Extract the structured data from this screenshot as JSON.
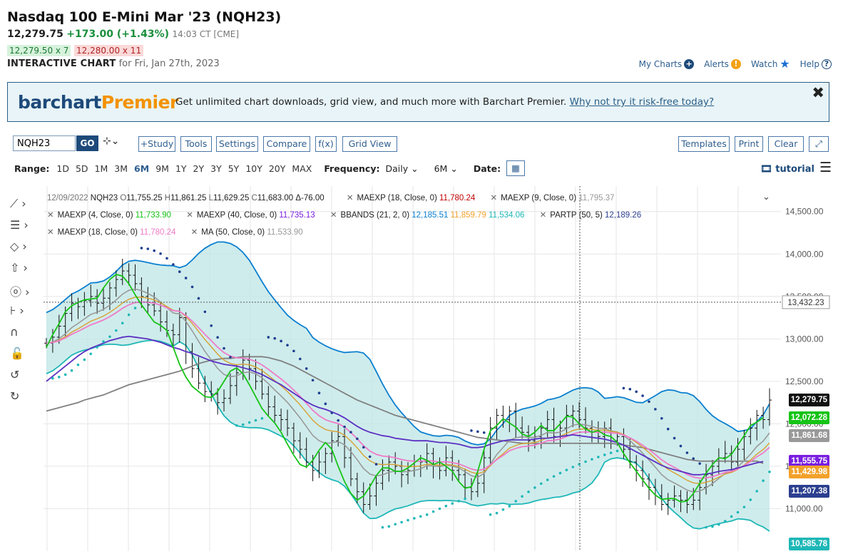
{
  "header": {
    "title": "Nasdaq 100 E-Mini Mar '23 (NQH23)",
    "last": "12,279.75",
    "change": "+173.00 (+1.43%)",
    "time": "14:03 CT [CME]",
    "bid": "12,279.50 x 7",
    "ask": "12,280.00 x 11",
    "interactive_label": "INTERACTIVE CHART",
    "interactive_sub": "for Fri, Jan 27th, 2023"
  },
  "toplinks": {
    "my_charts": "My Charts",
    "alerts": "Alerts",
    "watch": "Watch",
    "help": "Help"
  },
  "promo": {
    "logo_a": "barchart",
    "logo_b": "Premier",
    "message": "Get unlimited chart downloads, grid view, and much more with Barchart Premier.",
    "link": "Why not try it risk-free today?",
    "close": "✖"
  },
  "toolbar": {
    "symbol": "NQH23",
    "go": "GO",
    "buttons_left": [
      "+Study",
      "Tools",
      "Settings",
      "Compare",
      "f(x)",
      "Grid View"
    ],
    "buttons_right": [
      "Templates",
      "Print",
      "Clear"
    ]
  },
  "rangebar": {
    "range_label": "Range:",
    "ranges": [
      "1D",
      "5D",
      "1M",
      "3M",
      "6M",
      "9M",
      "1Y",
      "2Y",
      "3Y",
      "5Y",
      "10Y",
      "20Y",
      "MAX"
    ],
    "active_range": "6M",
    "frequency_label": "Frequency:",
    "frequency": "Daily",
    "period": "6M",
    "date_label": "Date:",
    "tutorial": "tutorial"
  },
  "legend": {
    "row1": {
      "date": "12/09/2022",
      "symbol": "NQH23",
      "ohlc": [
        "O",
        "11,755.25",
        "H",
        "11,861.25",
        "L",
        "11,629.25",
        "C",
        "11,683.00",
        "Δ-76.00"
      ],
      "s1": {
        "label": "MAEXP (18, Close, 0)",
        "value": "11,780.24"
      },
      "s2": {
        "label": "MAEXP (9, Close, 0)",
        "value": "11,795.37"
      }
    },
    "row2": [
      {
        "label": "MAEXP (4, Close, 0)",
        "value": "11,733.90"
      },
      {
        "label": "MAEXP (40, Close, 0)",
        "value": "11,735.13"
      },
      {
        "label": "BBANDS (21, 2, 0)",
        "values": [
          "12,185.51",
          "11,859.79",
          "11,534.06"
        ]
      },
      {
        "label": "PARTP (50, 5)",
        "value": "12,189.26"
      }
    ],
    "row3": [
      {
        "label": "MAEXP (18, Close, 0)",
        "value": "11,780.24"
      },
      {
        "label": "MA (50, Close, 0)",
        "value": "11,533.90"
      }
    ]
  },
  "colors": {
    "bb_band": "#0a7fd0",
    "bb_fill": "#bfe6e6",
    "maexp4": "#16c416",
    "maexp9": "#999999",
    "maexp18": "#f07ac8",
    "maexp40": "#5a2fc2",
    "ma50": "#808080",
    "sma_gold": "#d9a030",
    "sar": "#1fb7b7",
    "price": "#111111"
  },
  "chart_data": {
    "type": "candlestick",
    "y_ticks": [
      "14,500.00",
      "14,000.00",
      "13,500.00",
      "13,000.00",
      "12,500.00",
      "12,000.00",
      "11,500.00",
      "11,000.00"
    ],
    "ylim": [
      10500,
      14800
    ],
    "crosshair_value": "13,432.23",
    "price_labels": [
      {
        "value": "12,279.75",
        "color": "#111111"
      },
      {
        "value": "12,072.28",
        "color": "#16c416"
      },
      {
        "value": "11,861.68",
        "color": "#999999"
      },
      {
        "value": "11,555.75",
        "color": "#7a1ee0"
      },
      {
        "value": "11,429.98",
        "color": "#f2a12a"
      },
      {
        "value": "11,207.38",
        "color": "#2b3f8f"
      },
      {
        "value": "10,585.78",
        "color": "#1fb7b7"
      }
    ],
    "series": [
      {
        "name": "Close",
        "values": [
          12950,
          13020,
          13150,
          13300,
          13420,
          13380,
          13450,
          13500,
          13420,
          13480,
          13600,
          13700,
          13800,
          13750,
          13650,
          13500,
          13400,
          13330,
          13200,
          13100,
          13050,
          13250,
          12850,
          12650,
          12480,
          12380,
          12350,
          12250,
          12300,
          12450,
          12600,
          12750,
          12650,
          12500,
          12350,
          12200,
          12100,
          12050,
          11950,
          11800,
          11700,
          11550,
          11450,
          11550,
          11650,
          11800,
          11850,
          11600,
          11350,
          11200,
          11050,
          11150,
          11300,
          11450,
          11550,
          11500,
          11400,
          11450,
          11500,
          11550,
          11650,
          11500,
          11450,
          11600,
          11450,
          11400,
          11250,
          11200,
          11300,
          11600,
          11950,
          12100,
          12050,
          12150,
          11950,
          11900,
          11800,
          11850,
          11950,
          12050,
          11850,
          11950,
          12100,
          12150,
          12050,
          11950,
          11900,
          11850,
          11950,
          11800,
          11850,
          11700,
          11550,
          11450,
          11350,
          11250,
          11150,
          11050,
          11100,
          11150,
          11100,
          11050,
          11100,
          11250,
          11400,
          11500,
          11600,
          11650,
          11550,
          11700,
          11850,
          11950,
          12100,
          12050,
          12279.75
        ]
      },
      {
        "name": "MAEXP (4, Close, 0)",
        "values": [
          12900,
          13050,
          13180,
          13320,
          13390,
          13430,
          13460,
          13470,
          13480,
          13600,
          13700,
          13760,
          13740,
          13650,
          13520,
          13400,
          13300,
          13200,
          13160,
          13100,
          12900,
          12700,
          12550,
          12440,
          12380,
          12320,
          12310,
          12380,
          12500,
          12620,
          12660,
          12590,
          12460,
          12320,
          12180,
          12090,
          12010,
          11900,
          11760,
          11630,
          11520,
          11490,
          11570,
          11690,
          11780,
          11700,
          11500,
          11320,
          11180,
          11100,
          11150,
          11260,
          11390,
          11480,
          11480,
          11440,
          11440,
          11480,
          11540,
          11600,
          11570,
          11520,
          11550,
          11500,
          11440,
          11320,
          11240,
          11260,
          11440,
          11700,
          11920,
          11980,
          12060,
          12010,
          11960,
          11880,
          11850,
          11900,
          11980,
          11920,
          11920,
          12000,
          12090,
          12080,
          12000,
          11940,
          11900,
          11920,
          11870,
          11850,
          11780,
          11650,
          11540,
          11440,
          11340,
          11240,
          11160,
          11110,
          11120,
          11120,
          11080,
          11090,
          11180,
          11300,
          11420,
          11520,
          11600,
          11590,
          11640,
          11750,
          11860,
          11980,
          12020,
          12072.28
        ]
      },
      {
        "name": "MAEXP (40, Close, 0)",
        "values": [
          12500,
          12560,
          12620,
          12680,
          12740,
          12800,
          12850,
          12890,
          12920,
          12950,
          12980,
          13000,
          13020,
          13030,
          13020,
          13010,
          13000,
          12980,
          12960,
          12930,
          12900,
          12880,
          12850,
          12830,
          12800,
          12770,
          12740,
          12720,
          12700,
          12690,
          12680,
          12660,
          12640,
          12610,
          12580,
          12540,
          12500,
          12460,
          12410,
          12360,
          12310,
          12260,
          12220,
          12190,
          12170,
          12140,
          12110,
          12070,
          12020,
          11970,
          11930,
          11900,
          11880,
          11860,
          11850,
          11830,
          11820,
          11810,
          11800,
          11800,
          11800,
          11790,
          11780,
          11780,
          11770,
          11760,
          11740,
          11720,
          11720,
          11730,
          11760,
          11780,
          11800,
          11810,
          11810,
          11810,
          11810,
          11820,
          11830,
          11830,
          11840,
          11850,
          11860,
          11870,
          11860,
          11850,
          11840,
          11830,
          11820,
          11800,
          11780,
          11750,
          11710,
          11670,
          11630,
          11590,
          11550,
          11510,
          11480,
          11460,
          11440,
          11420,
          11400,
          11400,
          11410,
          11420,
          11440,
          11450,
          11460,
          11480,
          11500,
          11520,
          11540,
          11555.75
        ]
      },
      {
        "name": "MA (50, Close, 0)",
        "values": [
          12150,
          12170,
          12190,
          12210,
          12230,
          12250,
          12280,
          12300,
          12320,
          12340,
          12370,
          12400,
          12430,
          12460,
          12480,
          12500,
          12520,
          12540,
          12560,
          12580,
          12600,
          12620,
          12650,
          12680,
          12710,
          12730,
          12750,
          12760,
          12770,
          12770,
          12780,
          12790,
          12790,
          12790,
          12790,
          12780,
          12760,
          12740,
          12710,
          12680,
          12640,
          12600,
          12560,
          12520,
          12480,
          12440,
          12400,
          12360,
          12320,
          12280,
          12250,
          12220,
          12190,
          12160,
          12130,
          12100,
          12080,
          12060,
          12040,
          12020,
          12000,
          11980,
          11960,
          11940,
          11920,
          11900,
          11880,
          11860,
          11840,
          11830,
          11820,
          11810,
          11800,
          11790,
          11780,
          11770,
          11770,
          11770,
          11770,
          11770,
          11770,
          11770,
          11770,
          11770,
          11770,
          11770,
          11770,
          11770,
          11770,
          11770,
          11760,
          11750,
          11740,
          11730,
          11720,
          11700,
          11680,
          11660,
          11640,
          11620,
          11600,
          11580,
          11570,
          11560,
          11560,
          11560,
          11560,
          11560,
          11560,
          11560,
          11560,
          11560,
          11560,
          11533.9
        ]
      }
    ]
  }
}
